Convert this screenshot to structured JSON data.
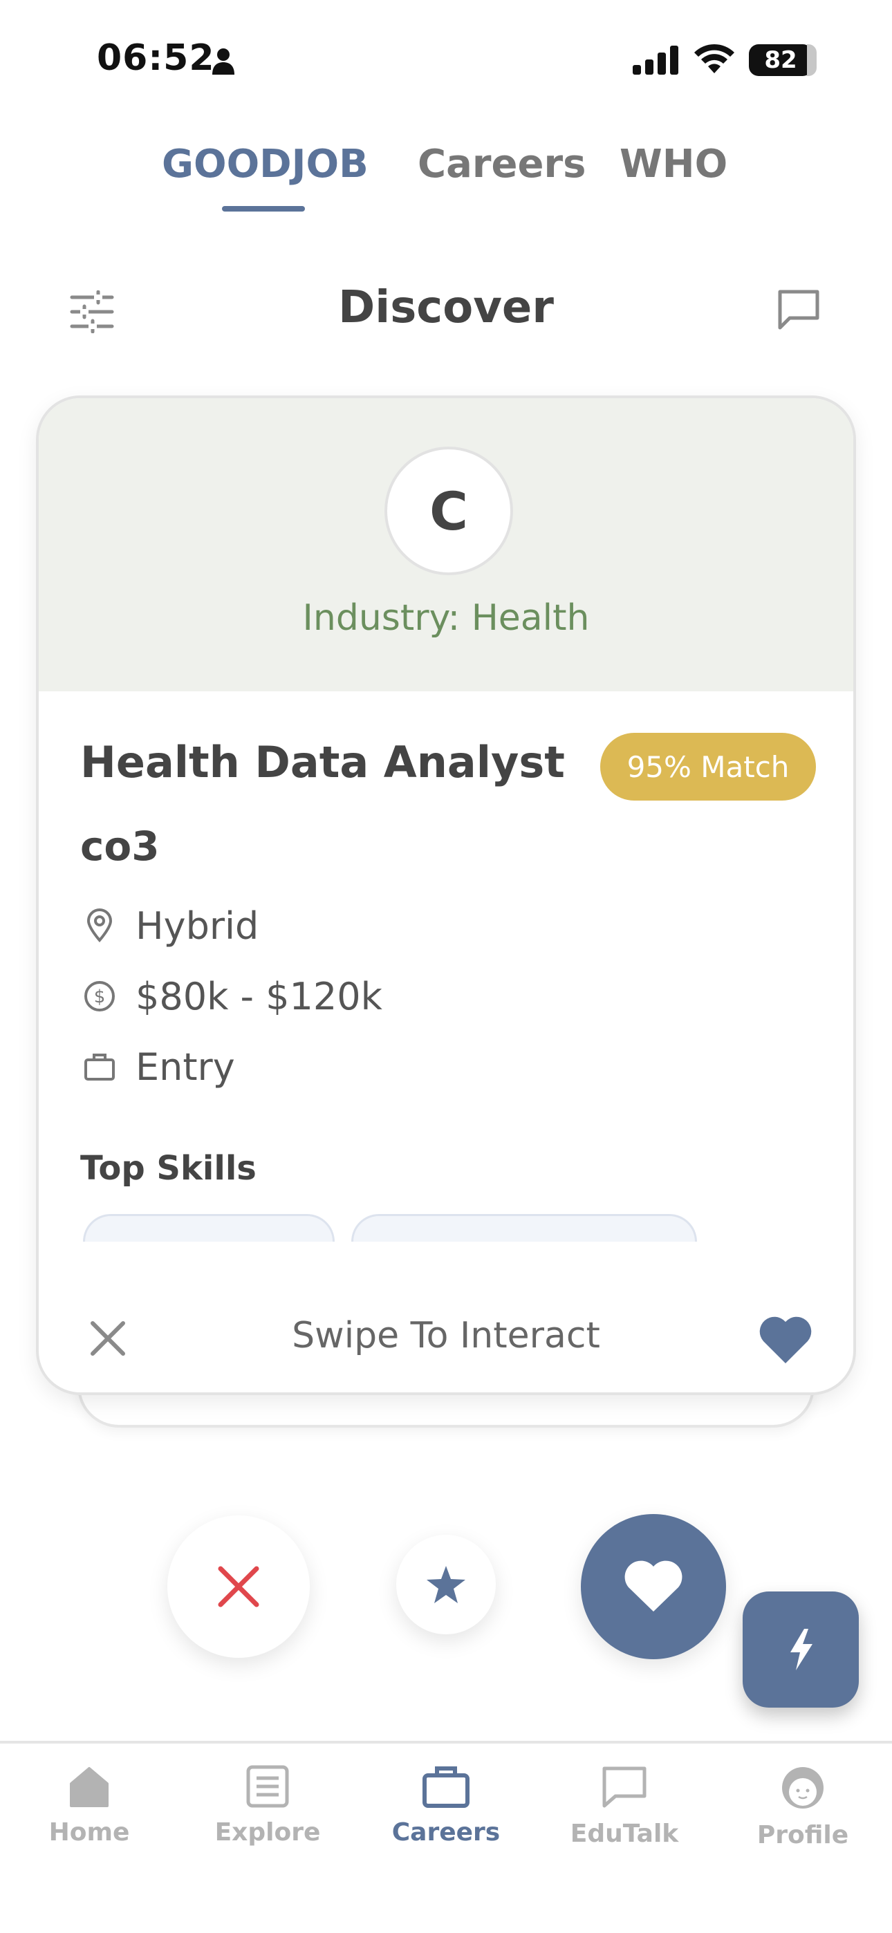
{
  "status_bar": {
    "time": "06:52",
    "battery": "82"
  },
  "top_tabs": [
    {
      "label": "GOODJOB",
      "active": true
    },
    {
      "label": "Careers",
      "active": false
    },
    {
      "label": "WHO",
      "active": false
    }
  ],
  "header": {
    "title": "Discover"
  },
  "job_card": {
    "company_initial": "C",
    "industry": "Industry: Health",
    "title": "Health Data Analyst",
    "match": "95% Match",
    "company": "co3",
    "location": "Hybrid",
    "salary": "$80k - $120k",
    "level": "Entry",
    "skills_title": "Top Skills",
    "footer_text": "Swipe To Interact"
  },
  "bottom_nav": [
    {
      "label": "Home",
      "icon": "home-icon"
    },
    {
      "label": "Explore",
      "icon": "explore-icon"
    },
    {
      "label": "Careers",
      "icon": "briefcase-icon",
      "active": true
    },
    {
      "label": "EduTalk",
      "icon": "chat-icon"
    },
    {
      "label": "Profile",
      "icon": "profile-icon"
    }
  ],
  "colors": {
    "accent": "#5b7399",
    "match_badge": "#dcb954",
    "industry_text": "#6b8f5e",
    "dislike": "#e0474c",
    "card_top_bg": "#eff1ec"
  }
}
